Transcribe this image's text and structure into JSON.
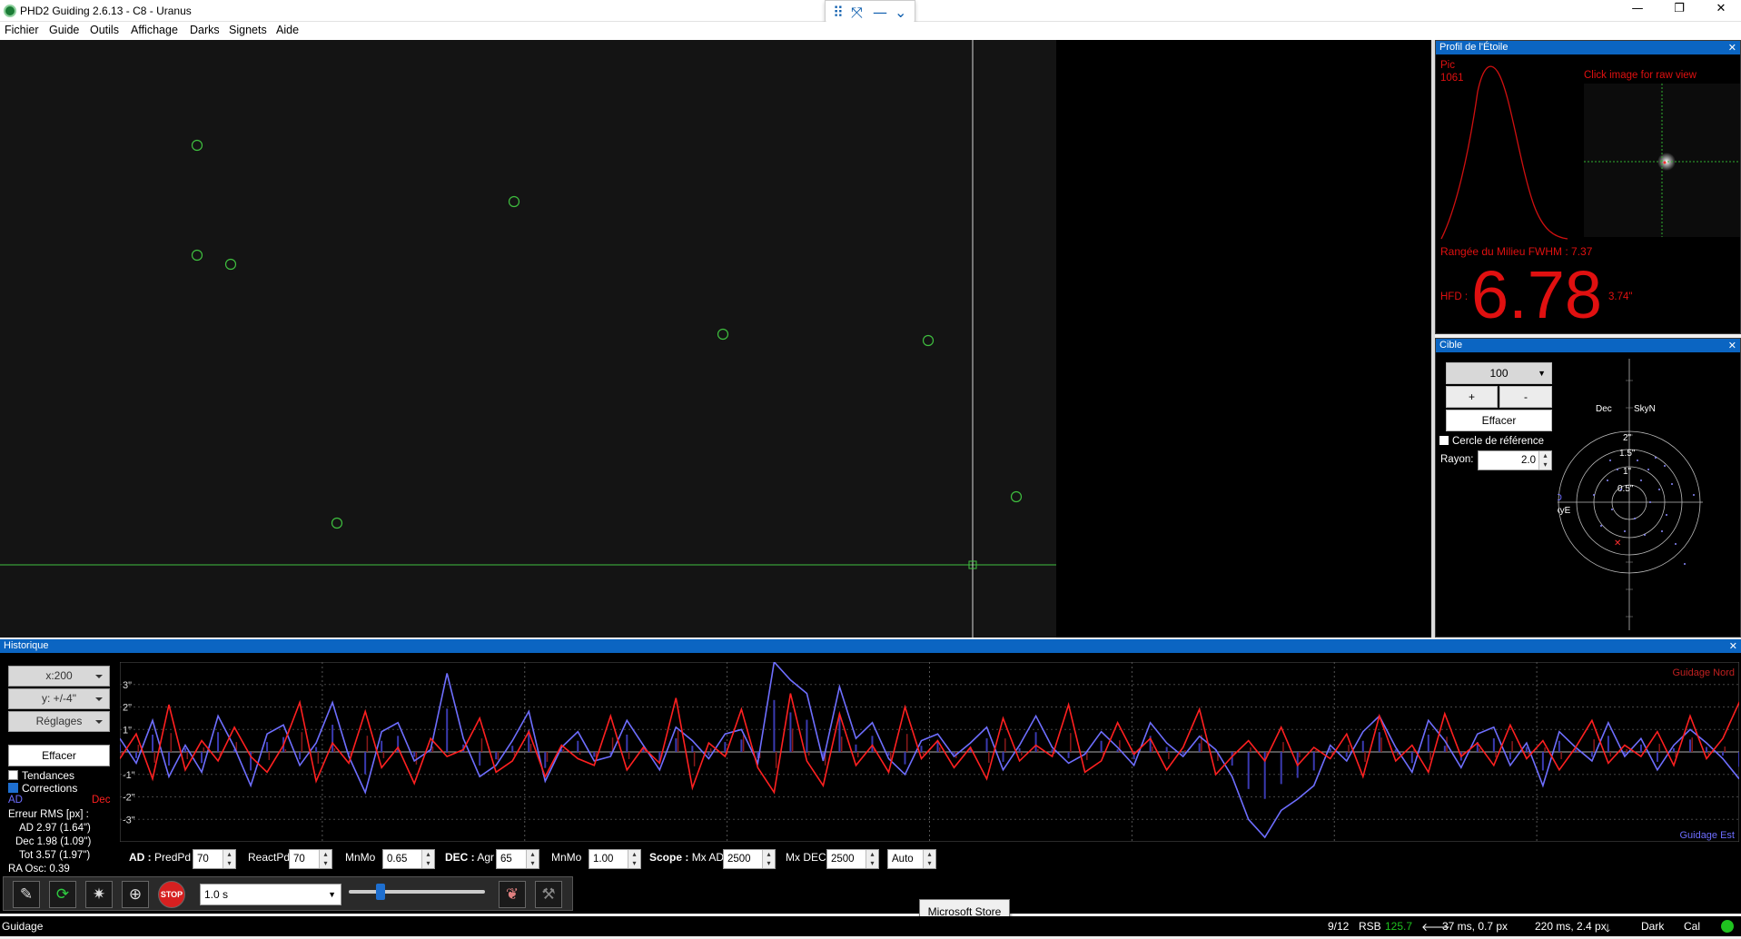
{
  "window": {
    "title": "PHD2 Guiding 2.6.13 - C8 - Uranus",
    "minimize": "—",
    "maximize": "❐",
    "close": "✕"
  },
  "menu": [
    "Fichier",
    "Guide",
    "Outils",
    "Affichage",
    "Darks",
    "Signets",
    "Aide"
  ],
  "star_profile": {
    "title": "Profil de l'Étoile",
    "pic_label": "Pic",
    "pic_value": "1061",
    "click_hint": "Click image for raw view",
    "fwhm_text": "Rangée du Milieu FWHM : 7.37",
    "hfd_label": "HFD :",
    "hfd_value": "6.78",
    "hfd_arcsec": "3.74\""
  },
  "target": {
    "title": "Cible",
    "zoom_value": "100",
    "plus": "+",
    "minus": "-",
    "clear": "Effacer",
    "ref_circle": "Cercle de référence",
    "radius_label": "Rayon:",
    "radius_value": "2.0",
    "dec_label": "Dec",
    "skyn": "SkyN",
    "ad_label": "AD",
    "skye": "SkyE",
    "ring_labels": [
      "2\"",
      "1.5\"",
      "1\"",
      "0.5\""
    ]
  },
  "history": {
    "title": "Historique",
    "x_scale": "x:200",
    "y_scale": "y: +/-4\"",
    "settings": "Réglages",
    "clear": "Effacer",
    "trends": "Tendances",
    "corrections": "Corrections",
    "ra_legend": "AD",
    "dec_legend": "Dec",
    "rms_title": "Erreur RMS [px] :",
    "rms_ad": "AD 2.97 (1.64\")",
    "rms_dec": "Dec 1.98 (1.09\")",
    "rms_tot": "Tot 3.57 (1.97\")",
    "ra_osc": "RA Osc: 0.39",
    "label_north": "Guidage Nord",
    "label_east": "Guidage Est",
    "y_ticks": [
      "3\"",
      "2\"",
      "1\"",
      "-1\"",
      "-2\"",
      "-3\""
    ]
  },
  "params": {
    "ad_head": "AD :",
    "predpd_label": "PredPd",
    "predpd": "70",
    "reactpd_label": "ReactPd",
    "reactpd": "70",
    "mnmo_label": "MnMo",
    "mnmo_ra": "0.65",
    "dec_head": "DEC :",
    "agr_label": "Agr",
    "agr": "65",
    "mnmo_dec": "1.00",
    "scope_head": "Scope :",
    "mxad_label": "Mx AD",
    "mxad": "2500",
    "mxdec_label": "Mx DEC",
    "mxdec": "2500",
    "mode": "Auto"
  },
  "toolbar": {
    "exposure": "1.0 s",
    "stop_label": "STOP"
  },
  "tooltip": "Microsoft Store",
  "status": {
    "mode": "Guidage",
    "frame": "9/12",
    "snr_label": "RSB",
    "snr": "125.7",
    "ra_pulse": "37 ms, 0.7 px",
    "dec_pulse": "220 ms, 2.4 px",
    "dark": "Dark",
    "cal": "Cal"
  },
  "colors": {
    "ra": "#6e6eff",
    "dec": "#ff2020",
    "title_bar_blue": "#0b65c2",
    "star_circle": "#3fbf3f",
    "status_ok": "#1fc21f"
  },
  "chart_data": {
    "type": "line",
    "title": "",
    "xlabel": "",
    "ylabel": "",
    "ylim": [
      -4,
      4
    ],
    "series": [
      {
        "name": "AD",
        "values": [
          0.6,
          -0.5,
          1.4,
          -1.1,
          0.3,
          -0.9,
          1.6,
          0.2,
          -1.5,
          0.8,
          1.2,
          -0.6,
          0.4,
          2.2,
          -0.2,
          -1.8,
          0.9,
          1.3,
          -0.4,
          0.1,
          3.5,
          0.6,
          -1.1,
          -0.6,
          0.5,
          1.8,
          -1.3,
          0.2,
          0.9,
          -0.4,
          -0.2,
          1.4,
          0.3,
          -0.8,
          1.1,
          0.5,
          -0.3,
          0.8,
          1.0,
          -0.5,
          4.2,
          3.2,
          2.6,
          -0.4,
          2.9,
          0.6,
          1.3,
          -0.3,
          -1.0,
          0.5,
          0.8,
          -0.2,
          0.4,
          1.1,
          -0.8,
          0.3,
          1.6,
          0.2,
          -0.5,
          -0.1,
          0.9,
          0.2,
          -0.6,
          1.3,
          0.4,
          -0.2,
          0.7,
          0.1,
          -1.1,
          -3.0,
          -3.8,
          -2.6,
          -2.1,
          -1.5,
          0.3,
          -0.4,
          0.9,
          1.6,
          0.2,
          -0.9,
          1.4,
          0.5,
          -0.7,
          0.8,
          1.1,
          -0.6,
          0.4,
          -1.5,
          0.9,
          0.2,
          -0.4,
          1.3,
          -0.2,
          0.6,
          -0.8,
          0.3,
          1.0,
          0.4,
          -0.3,
          -1.2
        ]
      },
      {
        "name": "Dec",
        "values": [
          -0.3,
          0.8,
          -1.2,
          2.1,
          -0.8,
          0.5,
          -0.4,
          1.1,
          -0.2,
          -0.9,
          0.3,
          2.2,
          -1.3,
          0.4,
          -0.5,
          1.8,
          -0.7,
          0.2,
          -1.4,
          0.6,
          -0.2,
          0.1,
          1.5,
          -0.9,
          -0.4,
          0.9,
          -1.1,
          0.3,
          -0.3,
          -0.6,
          1.6,
          -0.8,
          0.2,
          -0.5,
          2.4,
          -1.6,
          0.4,
          -0.2,
          1.9,
          -0.7,
          -1.8,
          2.6,
          -0.4,
          -1.5,
          1.7,
          -0.6,
          0.3,
          -0.9,
          2.0,
          -0.3,
          0.5,
          -0.7,
          0.2,
          -1.2,
          1.5,
          -0.4,
          0.3,
          -0.2,
          2.1,
          -0.9,
          -0.4,
          1.3,
          -0.1,
          0.6,
          -0.8,
          0.2,
          1.9,
          -1.0,
          -0.2,
          0.5,
          -0.4,
          1.1,
          -0.6,
          0.2,
          -0.3,
          0.8,
          -1.1,
          1.6,
          -0.4,
          0.3,
          -0.9,
          1.7,
          -0.2,
          0.4,
          -0.6,
          1.2,
          -0.3,
          0.5,
          -0.8,
          0.2,
          1.4,
          -0.5,
          0.3,
          -0.2,
          0.9,
          -0.6,
          1.6,
          -0.3,
          0.6,
          2.2,
          -0.4,
          0.6
        ]
      }
    ]
  }
}
